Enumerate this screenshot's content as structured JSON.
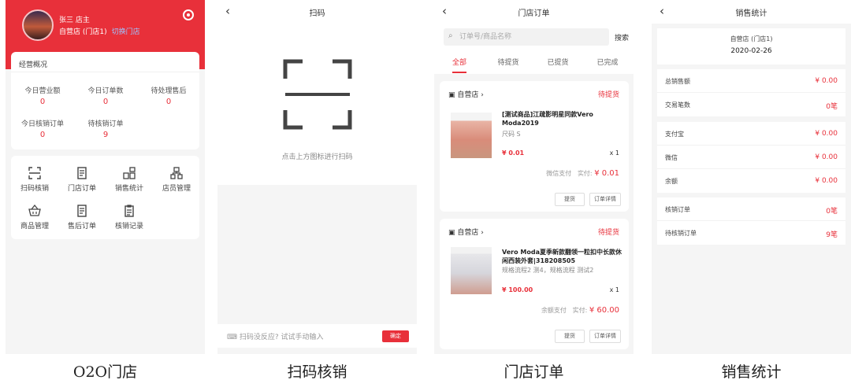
{
  "captions": [
    "O2O门店",
    "扫码核销",
    "门店订单",
    "销售统计"
  ],
  "store_home": {
    "user": "张三 店主",
    "store": "自营店 (门店1)",
    "switch_link": "切换门店",
    "overview_title": "经营概况",
    "stats": [
      {
        "label": "今日营业额",
        "value": "0"
      },
      {
        "label": "今日订单数",
        "value": "0"
      },
      {
        "label": "待处理售后",
        "value": "0"
      },
      {
        "label": "今日核销订单",
        "value": "0"
      },
      {
        "label": "待核销订单",
        "value": "9"
      }
    ],
    "tools": [
      {
        "label": "扫码核销",
        "icon": "scan-icon"
      },
      {
        "label": "门店订单",
        "icon": "order-icon"
      },
      {
        "label": "销售统计",
        "icon": "stats-icon"
      },
      {
        "label": "店员管理",
        "icon": "staff-icon"
      },
      {
        "label": "商品管理",
        "icon": "basket-icon"
      },
      {
        "label": "售后订单",
        "icon": "aftersale-icon"
      },
      {
        "label": "核销记录",
        "icon": "record-icon"
      }
    ]
  },
  "scan": {
    "title": "扫码",
    "hint": "点击上方图标进行扫码",
    "manual": "扫码没反应? 试试手动输入",
    "confirm": "确定"
  },
  "orders": {
    "title": "门店订单",
    "search_placeholder": "订单号/商品名称",
    "search_button": "搜索",
    "tabs": [
      "全部",
      "待提货",
      "已提货",
      "已完成"
    ],
    "list": [
      {
        "store": "自营店",
        "status": "待提货",
        "title": "[测试商品]江疏影明星同款Vero Moda2019",
        "spec": "尺码 S",
        "price": "¥ 0.01",
        "qty": "x 1",
        "pay_method": "微信支付",
        "paid_label": "实付:",
        "paid": "¥ 0.01",
        "btn1": "提货",
        "btn2": "订单详情"
      },
      {
        "store": "自营店",
        "status": "待提货",
        "title": "Vero Moda夏季新款翻领一粒扣中长款休闲西装外套|318208505",
        "spec": "规格流程2 测4，规格流程 测试2",
        "price": "¥ 100.00",
        "qty": "x 1",
        "pay_method": "余额支付",
        "paid_label": "实付:",
        "paid": "¥ 60.00",
        "btn1": "提货",
        "btn2": "订单详情"
      }
    ]
  },
  "sales": {
    "title": "销售统计",
    "store": "自营店 (门店1)",
    "date": "2020-02-26",
    "group1": [
      {
        "label": "总销售额",
        "value": "¥ 0.00"
      },
      {
        "label": "交易笔数",
        "value": "0笔"
      }
    ],
    "group2": [
      {
        "label": "支付宝",
        "value": "¥ 0.00"
      },
      {
        "label": "微信",
        "value": "¥ 0.00"
      },
      {
        "label": "余额",
        "value": "¥ 0.00"
      }
    ],
    "group3": [
      {
        "label": "核销订单",
        "value": "0笔"
      },
      {
        "label": "待核销订单",
        "value": "9笔"
      }
    ]
  },
  "colors": {
    "accent": "#e8303a",
    "background": "#f5f5f5"
  }
}
